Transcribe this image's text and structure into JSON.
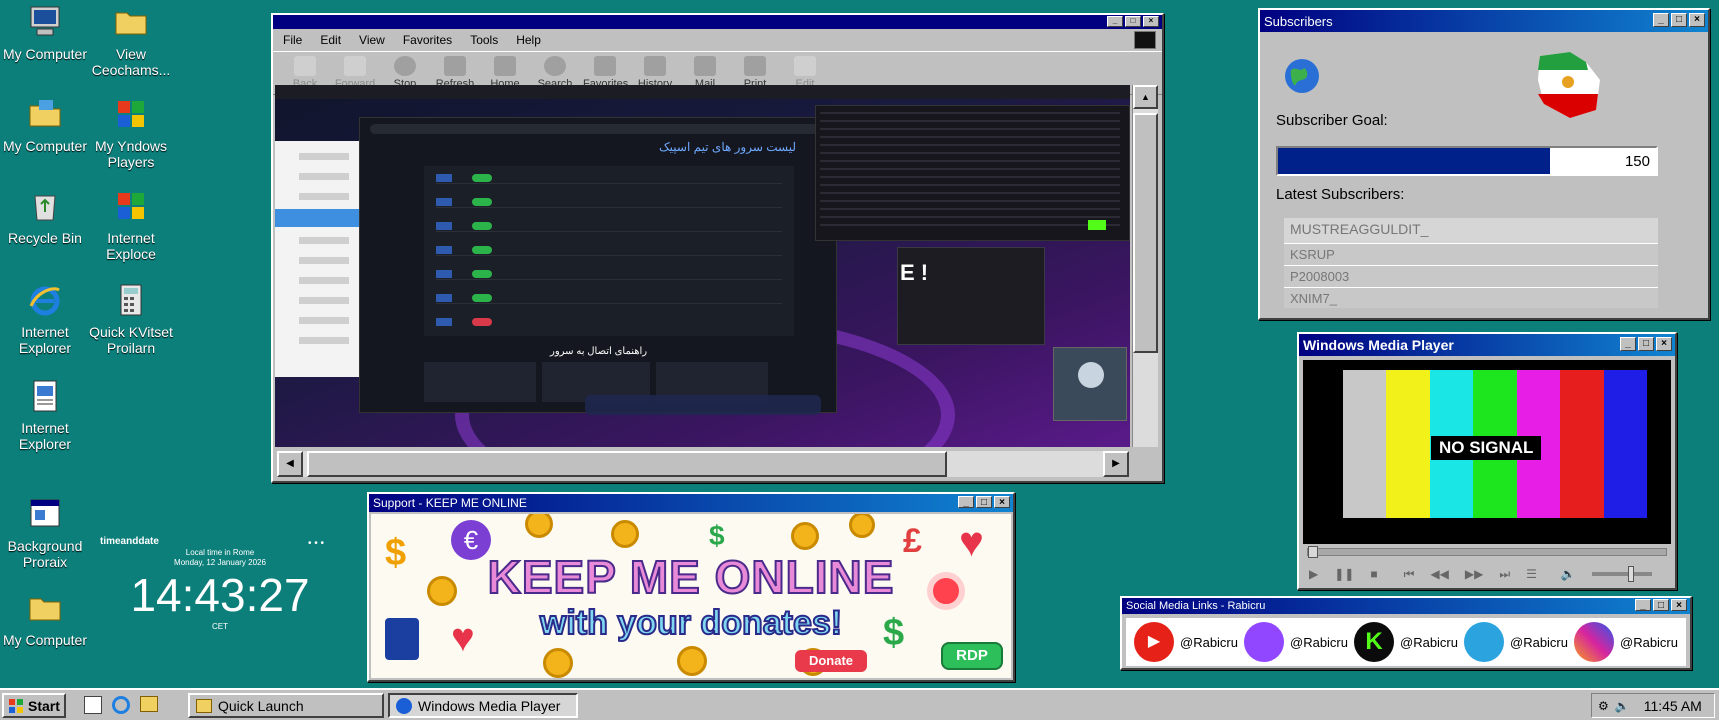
{
  "desktop_icons": [
    {
      "label": "My Computer",
      "icon": "computer-icon"
    },
    {
      "label": "View Ceochams...",
      "icon": "folder-icon"
    },
    {
      "label": "My Computer",
      "icon": "briefcase-folder-icon"
    },
    {
      "label": "My Yndows Players",
      "icon": "windows-logo-icon"
    },
    {
      "label": "Recycle Bin",
      "icon": "recycle-bin-icon"
    },
    {
      "label": "Internet Exploce",
      "icon": "windows-logo-icon"
    },
    {
      "label": "Internet Explorer",
      "icon": "internet-explorer-icon"
    },
    {
      "label": "Quick KVitset Proilarn",
      "icon": "calculator-icon"
    },
    {
      "label": "Internet Explorer",
      "icon": "document-icon"
    },
    {
      "label": "Background Proraix",
      "icon": "window-app-icon"
    },
    {
      "label": "My Computer",
      "icon": "folder-icon"
    }
  ],
  "clock_widget": {
    "brand": "timeanddate",
    "caption": "Local time in Rome",
    "date": "Monday, 12 January 2026",
    "time": "14:43:27",
    "zone": "CET"
  },
  "browser": {
    "menu": [
      "File",
      "Edit",
      "View",
      "Favorites",
      "Tools",
      "Help"
    ],
    "toolbar": [
      {
        "label": "Back",
        "enabled": false
      },
      {
        "label": "Forward",
        "enabled": false
      },
      {
        "label": "Stop",
        "enabled": true
      },
      {
        "label": "Refresh",
        "enabled": true
      },
      {
        "label": "Home",
        "enabled": true
      },
      {
        "label": "Search",
        "enabled": true
      },
      {
        "label": "Favorites",
        "enabled": true
      },
      {
        "label": "History",
        "enabled": true
      },
      {
        "label": "Mail",
        "enabled": true
      },
      {
        "label": "Print",
        "enabled": true
      },
      {
        "label": "Edit",
        "enabled": false
      }
    ],
    "stream_title": "لیست سرور های تیم اسپیک",
    "stream_subtitle": "راهنمای اتصال به سرور",
    "big_text": "E !"
  },
  "subscribers": {
    "title": "Subscribers",
    "goal_label": "Subscriber Goal:",
    "goal_value": "150",
    "goal_progress": 0.72,
    "latest_label": "Latest Subscribers:",
    "list": [
      "MUSTREAGGULDIT_",
      "KSRUP",
      "P2008003",
      "XNIM7_"
    ]
  },
  "media_player": {
    "title": "Windows Media Player",
    "overlay": "NO SIGNAL",
    "bar_colors": [
      "#c8c8c8",
      "#f2f21a",
      "#1ae6e6",
      "#1ee61e",
      "#e61ee6",
      "#e61e1e",
      "#1e1ee6"
    ]
  },
  "support": {
    "title": "Support - KEEP ME ONLINE",
    "headline": "KEEP ME ONLINE",
    "subline": "with your donates!",
    "donate": "Donate",
    "rdp": "RDP",
    "symbols": [
      "$",
      "€",
      "£",
      "♥"
    ]
  },
  "social": {
    "title": "Social Media Links - Rabicru",
    "links": [
      {
        "handle": "@Rabicru",
        "icon": "youtube-icon",
        "color": "#e62117"
      },
      {
        "handle": "@Rabicru",
        "icon": "twitch-icon",
        "color": "#9146ff"
      },
      {
        "handle": "@Rabicru",
        "icon": "kick-icon",
        "color": "#53fc18"
      },
      {
        "handle": "@Rabicru",
        "icon": "telegram-icon",
        "color": "#2aa3df"
      },
      {
        "handle": "@Rabicru",
        "icon": "instagram-icon",
        "color": "#d6249f"
      }
    ]
  },
  "taskbar": {
    "start": "Start",
    "tasks": [
      "Quick Launch",
      "Windows Media Player"
    ],
    "time": "11:45 AM"
  }
}
